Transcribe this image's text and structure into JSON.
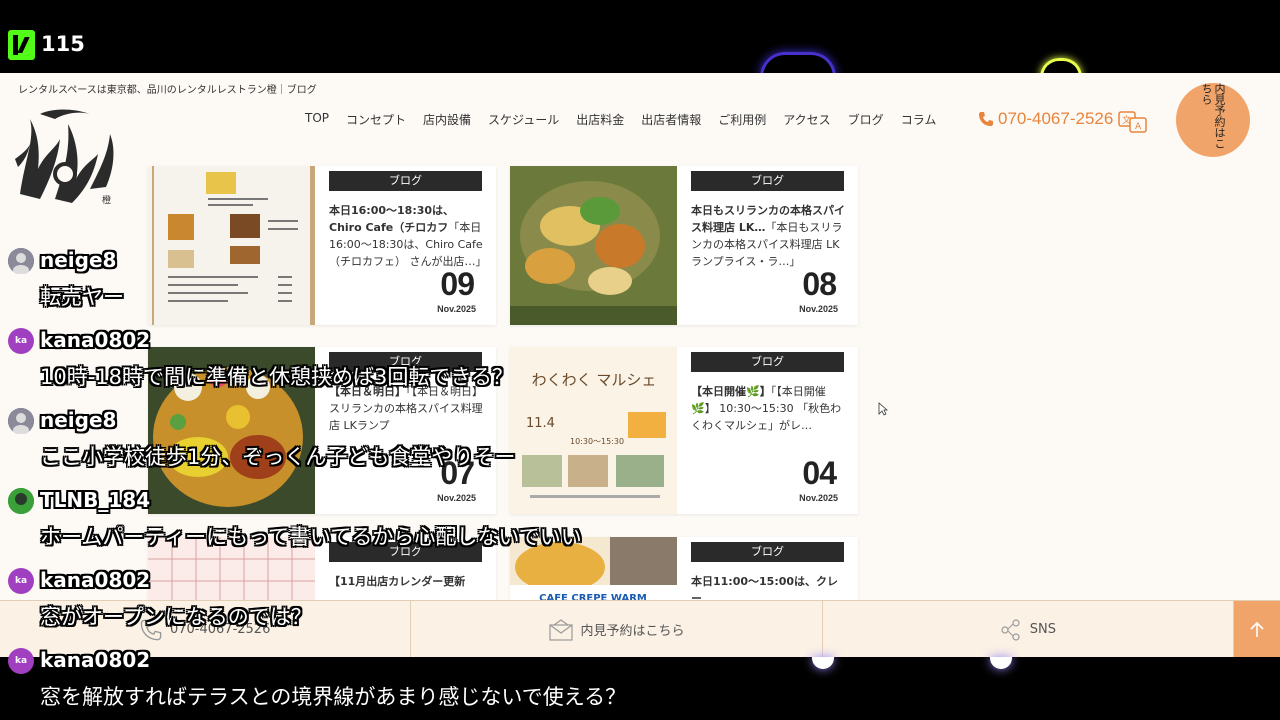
{
  "stream": {
    "viewer_count": "115",
    "platform_icon": "kick-logo-icon"
  },
  "site": {
    "tagline": "レンタルスペースは東京都、品川のレンタルレストラン橙｜ブログ",
    "logo_icon": "dai-logo-icon",
    "nav": [
      "TOP",
      "コンセプト",
      "店内設備",
      "スケジュール",
      "出店料金",
      "出店者情報",
      "ご利用例",
      "アクセス",
      "ブログ",
      "コラム"
    ],
    "phone": "070-4067-2526",
    "reserve_label": "内見予約はこちら",
    "accent_color": "#f0a46a"
  },
  "cards": [
    {
      "tag": "ブログ",
      "title": "本日16:00〜18:30は、Chiro Cafe（チロカフ",
      "excerpt": "「本日16:00〜18:30は、Chiro Cafe（チロカフェ） さんが出店…」",
      "day": "09",
      "month": "Nov.2025"
    },
    {
      "tag": "ブログ",
      "title": "本日もスリランカの本格スパイス料理店 LK…",
      "excerpt": "「本日もスリランカの本格スパイス料理店 LKランプライス・ラ…」",
      "day": "08",
      "month": "Nov.2025"
    },
    {
      "tag": "ブログ",
      "title": "【本日＆明日】",
      "excerpt": "「【本日＆明日】 スリランカの本格スパイス料理店 LKランプ",
      "day": "07",
      "month": "Nov.2025"
    },
    {
      "tag": "ブログ",
      "title": "【本日開催🌿】",
      "excerpt": "「【本日開催🌿】 10:30〜15:30 「秋色わくわくマルシェ」がレ…",
      "day": "04",
      "month": "Nov.2025"
    },
    {
      "tag": "ブログ",
      "title": "【11月出店カレンダー更新",
      "excerpt": "",
      "day": "",
      "month": ""
    },
    {
      "tag": "ブログ",
      "title": "本日11:00〜15:00は、クレー",
      "excerpt": "",
      "day": "",
      "month": ""
    }
  ],
  "card_images": {
    "marche_title": "わくわく マルシェ",
    "marche_date": "11.4",
    "marche_time": "10:30〜15:30",
    "crepe_sign": "CAFE CREPE WARM"
  },
  "bottom_bar": {
    "phone": "070-4067-2526",
    "reserve": "内見予約はこちら",
    "sns": "SNS"
  },
  "chat": [
    {
      "user": "neige8",
      "avatar": "photo",
      "message": "転売ヤー"
    },
    {
      "user": "kana0802",
      "avatar": "ka",
      "message": "10時-18時で間に準備と休憩挟めば3回転できる？"
    },
    {
      "user": "neige8",
      "avatar": "photo",
      "message": "ここ小学校徒歩1分、ぞっくん子ども食堂やりそー"
    },
    {
      "user": "TLNB_184",
      "avatar": "photo-green",
      "message": "ホームパーティーにもって書いてるから心配しないでいい"
    },
    {
      "user": "kana0802",
      "avatar": "ka",
      "message": "窓がオープンになるのでは？"
    },
    {
      "user": "kana0802",
      "avatar": "ka",
      "message": "窓を解放すればテラスとの境界線があまり感じないで使える？"
    }
  ]
}
